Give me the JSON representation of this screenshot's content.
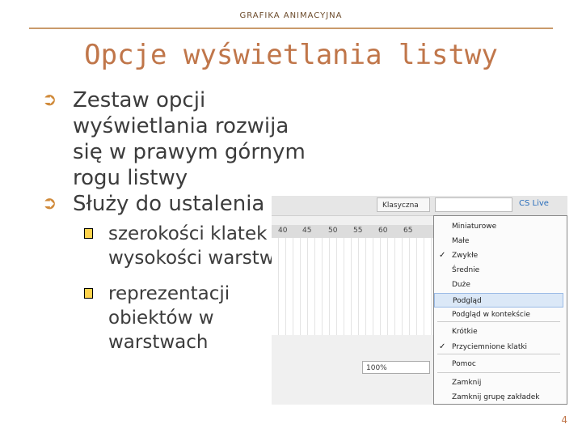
{
  "header": {
    "label": "GRAFIKA ANIMACYJNA"
  },
  "title": "Opcje wyświetlania listwy",
  "bullets": [
    {
      "text": "Zestaw opcji wyświetlania rozwija się w prawym górnym rogu listwy"
    },
    {
      "text": "Służy do ustalenia :"
    }
  ],
  "subbullets": [
    {
      "text": "szerokości klatek i wysokości warstw"
    },
    {
      "text": "reprezentacji obiektów w warstwach"
    }
  ],
  "screenshot": {
    "workspace_label": "Klasyczna",
    "cs_live_label": "CS Live",
    "ruler_ticks": [
      "40",
      "45",
      "50",
      "55",
      "60",
      "65"
    ],
    "zoom_value": "100%",
    "menu_items": [
      {
        "label": "Miniaturowe",
        "checked": false,
        "selected": false
      },
      {
        "label": "Małe",
        "checked": false,
        "selected": false
      },
      {
        "label": "Zwykłe",
        "checked": true,
        "selected": false
      },
      {
        "label": "Średnie",
        "checked": false,
        "selected": false
      },
      {
        "label": "Duże",
        "checked": false,
        "selected": false
      },
      {
        "label": "Podgląd",
        "checked": false,
        "selected": true
      },
      {
        "label": "Podgląd w kontekście",
        "checked": false,
        "selected": false
      },
      {
        "label": "Krótkie",
        "checked": false,
        "selected": false
      },
      {
        "label": "Przyciemnione klatki",
        "checked": true,
        "selected": false
      },
      {
        "label": "Pomoc",
        "checked": false,
        "selected": false
      },
      {
        "label": "Zamknij",
        "checked": false,
        "selected": false
      },
      {
        "label": "Zamknij grupę zakładek",
        "checked": false,
        "selected": false
      }
    ]
  },
  "page_number": "4"
}
